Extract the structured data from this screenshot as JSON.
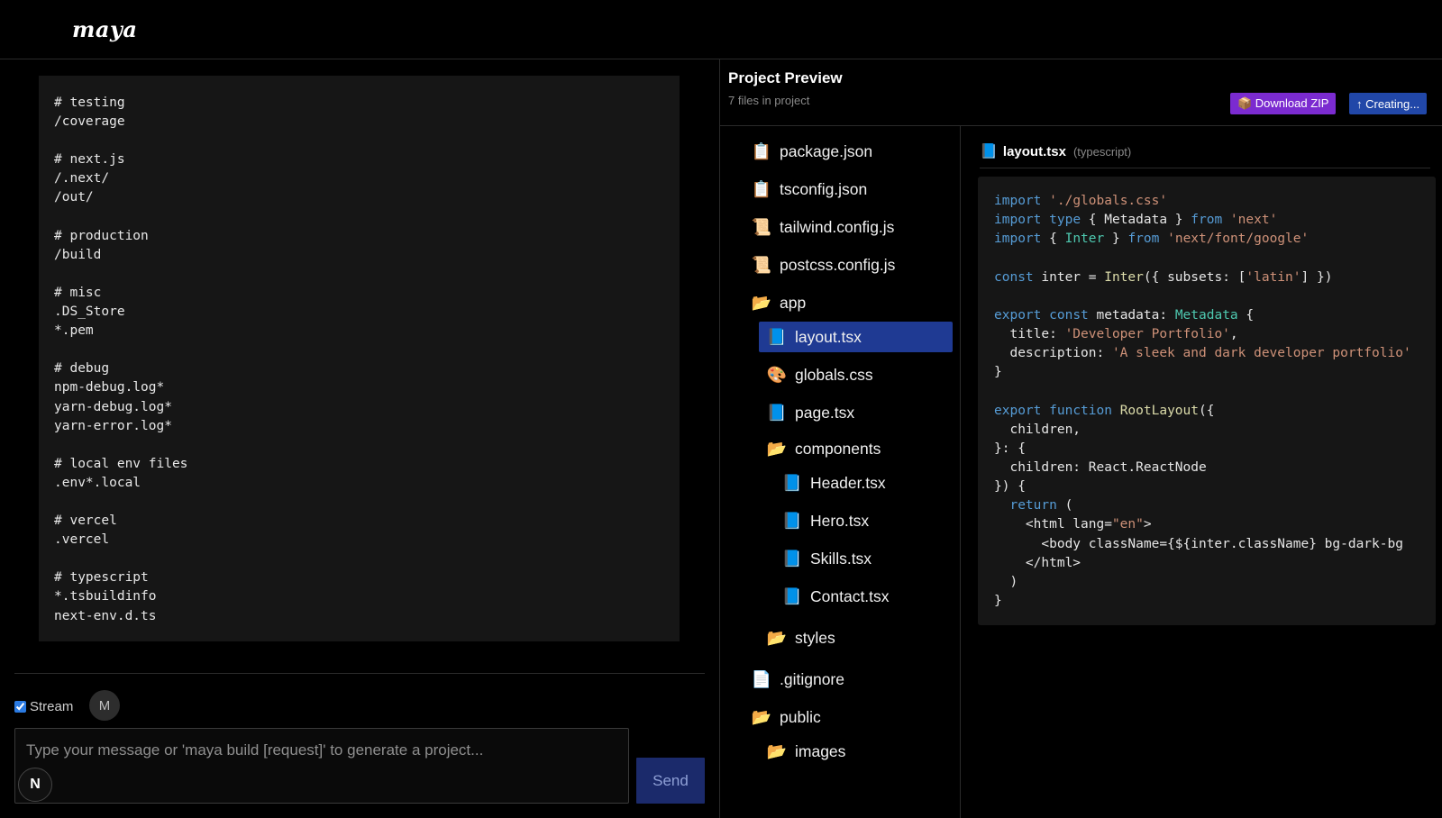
{
  "app": {
    "logo": "maya"
  },
  "chat": {
    "code_lines": [
      "# testing",
      "/coverage",
      "",
      "# next.js",
      "/.next/",
      "/out/",
      "",
      "# production",
      "/build",
      "",
      "# misc",
      ".DS_Store",
      "*.pem",
      "",
      "# debug",
      "npm-debug.log*",
      "yarn-debug.log*",
      "yarn-error.log*",
      "",
      "# local env files",
      ".env*.local",
      "",
      "# vercel",
      ".vercel",
      "",
      "# typescript",
      "*.tsbuildinfo",
      "next-env.d.ts"
    ],
    "stream_label": "Stream",
    "stream_checked": true,
    "avatar_letter": "M",
    "input_placeholder": "Type your message or 'maya build [request]' to generate a project...",
    "n_button": "N",
    "send_label": "Send"
  },
  "preview": {
    "title": "Project Preview",
    "subtitle": "7 files in project",
    "download_label": "📦 Download ZIP",
    "create_label": "↑ Creating...",
    "tree": [
      {
        "icon": "📋",
        "icon_name": "json-file-icon",
        "label": "package.json"
      },
      {
        "icon": "📋",
        "icon_name": "json-file-icon",
        "label": "tsconfig.json"
      },
      {
        "icon": "📜",
        "icon_name": "js-file-icon",
        "label": "tailwind.config.js"
      },
      {
        "icon": "📜",
        "icon_name": "js-file-icon",
        "label": "postcss.config.js"
      },
      {
        "icon": "📂",
        "icon_name": "folder-open-icon",
        "label": "app"
      },
      {
        "icon": "📘",
        "icon_name": "tsx-file-icon",
        "label": "layout.tsx",
        "selected": true
      },
      {
        "icon": "🎨",
        "icon_name": "css-file-icon",
        "label": "globals.css"
      },
      {
        "icon": "📘",
        "icon_name": "tsx-file-icon",
        "label": "page.tsx"
      },
      {
        "icon": "📂",
        "icon_name": "folder-open-icon",
        "label": "components"
      },
      {
        "icon": "📘",
        "icon_name": "tsx-file-icon",
        "label": "Header.tsx"
      },
      {
        "icon": "📘",
        "icon_name": "tsx-file-icon",
        "label": "Hero.tsx"
      },
      {
        "icon": "📘",
        "icon_name": "tsx-file-icon",
        "label": "Skills.tsx"
      },
      {
        "icon": "📘",
        "icon_name": "tsx-file-icon",
        "label": "Contact.tsx"
      },
      {
        "icon": "📂",
        "icon_name": "folder-open-icon",
        "label": "styles"
      },
      {
        "icon": "📄",
        "icon_name": "file-icon",
        "label": ".gitignore"
      },
      {
        "icon": "📂",
        "icon_name": "folder-open-icon",
        "label": "public"
      },
      {
        "icon": "📂",
        "icon_name": "folder-open-icon",
        "label": "images"
      }
    ],
    "editor": {
      "icon": "📘",
      "filename": "layout.tsx",
      "language": "(typescript)",
      "code": [
        [
          [
            "kw",
            "import"
          ],
          [
            "pl",
            " "
          ],
          [
            "str",
            "'./globals.css'"
          ]
        ],
        [
          [
            "kw",
            "import"
          ],
          [
            "pl",
            " "
          ],
          [
            "kw",
            "type"
          ],
          [
            "pl",
            " { Metadata } "
          ],
          [
            "kw",
            "from"
          ],
          [
            "pl",
            " "
          ],
          [
            "str",
            "'next'"
          ]
        ],
        [
          [
            "kw",
            "import"
          ],
          [
            "pl",
            " { "
          ],
          [
            "ty",
            "Inter"
          ],
          [
            "pl",
            " } "
          ],
          [
            "kw",
            "from"
          ],
          [
            "pl",
            " "
          ],
          [
            "str",
            "'next/font/google'"
          ]
        ],
        [],
        [
          [
            "kw",
            "const"
          ],
          [
            "pl",
            " inter = "
          ],
          [
            "fn",
            "Inter"
          ],
          [
            "pl",
            "({ subsets: ["
          ],
          [
            "str",
            "'latin'"
          ],
          [
            "pl",
            "] })"
          ]
        ],
        [],
        [
          [
            "kw",
            "export"
          ],
          [
            "pl",
            " "
          ],
          [
            "kw",
            "const"
          ],
          [
            "pl",
            " metadata: "
          ],
          [
            "ty",
            "Metadata"
          ],
          [
            "pl",
            " {"
          ]
        ],
        [
          [
            "pl",
            "  title: "
          ],
          [
            "str",
            "'Developer Portfolio'"
          ],
          [
            "pl",
            ","
          ]
        ],
        [
          [
            "pl",
            "  description: "
          ],
          [
            "str",
            "'A sleek and dark developer portfolio'"
          ]
        ],
        [
          [
            "pl",
            "}"
          ]
        ],
        [],
        [
          [
            "kw",
            "export"
          ],
          [
            "pl",
            " "
          ],
          [
            "kw",
            "function"
          ],
          [
            "pl",
            " "
          ],
          [
            "fn",
            "RootLayout"
          ],
          [
            "pl",
            "({"
          ]
        ],
        [
          [
            "pl",
            "  children,"
          ]
        ],
        [
          [
            "pl",
            "}: {"
          ]
        ],
        [
          [
            "pl",
            "  children: React.ReactNode"
          ]
        ],
        [
          [
            "pl",
            "}) {"
          ]
        ],
        [
          [
            "pl",
            "  "
          ],
          [
            "kw",
            "return"
          ],
          [
            "pl",
            " ("
          ]
        ],
        [
          [
            "pl",
            "    <html lang="
          ],
          [
            "str",
            "\"en\""
          ],
          [
            "pl",
            ">"
          ]
        ],
        [
          [
            "pl",
            "      <body className={${inter.className} bg-dark-bg"
          ]
        ],
        [
          [
            "pl",
            "    </html>"
          ]
        ],
        [
          [
            "pl",
            "  )"
          ]
        ],
        [
          [
            "pl",
            "}"
          ]
        ]
      ]
    }
  }
}
